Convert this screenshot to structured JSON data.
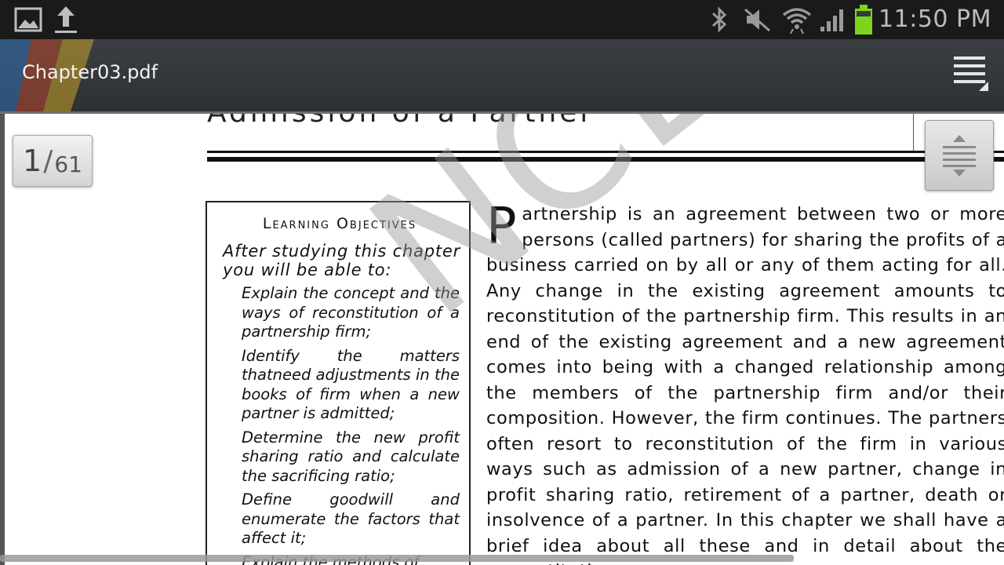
{
  "status_bar": {
    "time": "11:50 PM",
    "icons": [
      "gallery-icon",
      "upload-icon",
      "bluetooth-icon",
      "mute-icon",
      "wifi-icon",
      "signal-icon",
      "battery-icon"
    ],
    "battery_color": "#7ed31c"
  },
  "app_bar": {
    "title": "Chapter03.pdf",
    "menu_icon": "menu-lines-icon"
  },
  "page_indicator": {
    "current": "1",
    "separator": "/",
    "total": "61"
  },
  "document": {
    "heading": "Admission of a Partner",
    "learning_objectives": {
      "title": "Learning Objectives",
      "intro": "After studying this chapter you will be able to:",
      "bullet_glyph": "",
      "items": [
        "Explain the concept and the ways of reconstitution of a partnership firm;",
        "Identify the matters thatneed adjustments in the books of firm when a new partner is admitted;",
        "Determine the new profit sharing ratio and calculate the sacrificing ratio;",
        "Define goodwill and enumerate the factors that affect it;",
        "Explain the methods of"
      ]
    },
    "body": {
      "dropcap": "P",
      "text": "artnership is an agreement between two or more persons (called partners) for sharing the profits of a business carried on by all or any of them acting for all. Any change in the existing agreement amounts to reconstitution of the partnership firm. This results in an end of the existing agreement and a new agreement comes into being with a changed relationship among the members of the partnership firm and/or their composition. However, the firm continues. The partners often resort to reconstitution of the firm in various ways such as admission of a new partner, change in profit sharing ratio, retirement of a partner, death or insolvence of a partner. In this chapter we shall have a brief idea about all these and in detail about the reconstitution"
    },
    "watermark": "NCERT republish"
  }
}
